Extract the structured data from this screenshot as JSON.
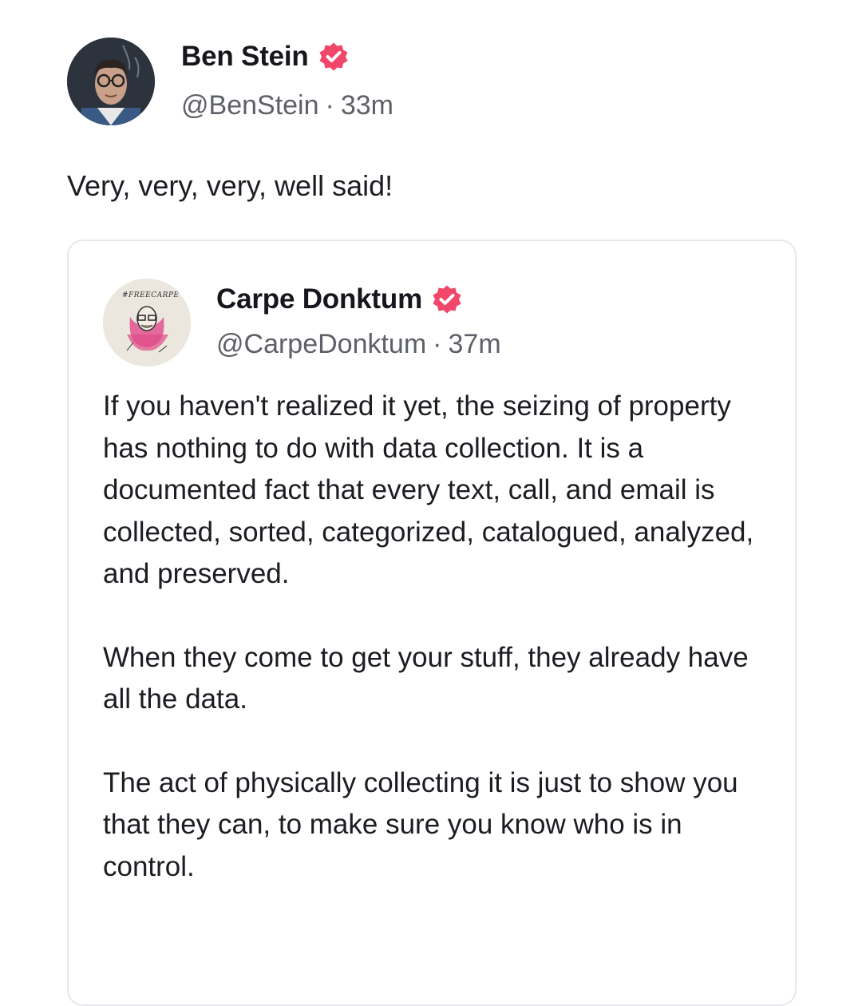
{
  "post": {
    "author": {
      "name": "Ben Stein",
      "handle": "@BenStein",
      "time": "33m",
      "avatar_icon": "profile-photo",
      "verified_icon": "verified-badge-icon"
    },
    "text": "Very, very, very, well said!",
    "quoted": {
      "author": {
        "name": "Carpe Donktum",
        "handle": "@CarpeDonktum",
        "time": "37m",
        "avatar_icon": "profile-illustration",
        "avatar_caption": "#FREECARPE"
      },
      "paragraphs": [
        "If you haven't realized it yet, the seizing of property has nothing to do with data collection. It is a documented fact that every text, call, and email is collected, sorted, categorized, catalogued, analyzed, and preserved.",
        "When they come to get your stuff, they already have all the data.",
        "The act of physically collecting it is just to show you that they can, to make sure you know who is in control."
      ]
    },
    "separator": "·",
    "colors": {
      "verified": "#f0476a",
      "text": "#1c1c22",
      "muted": "#5e6068",
      "border": "#e8e8ec"
    }
  }
}
